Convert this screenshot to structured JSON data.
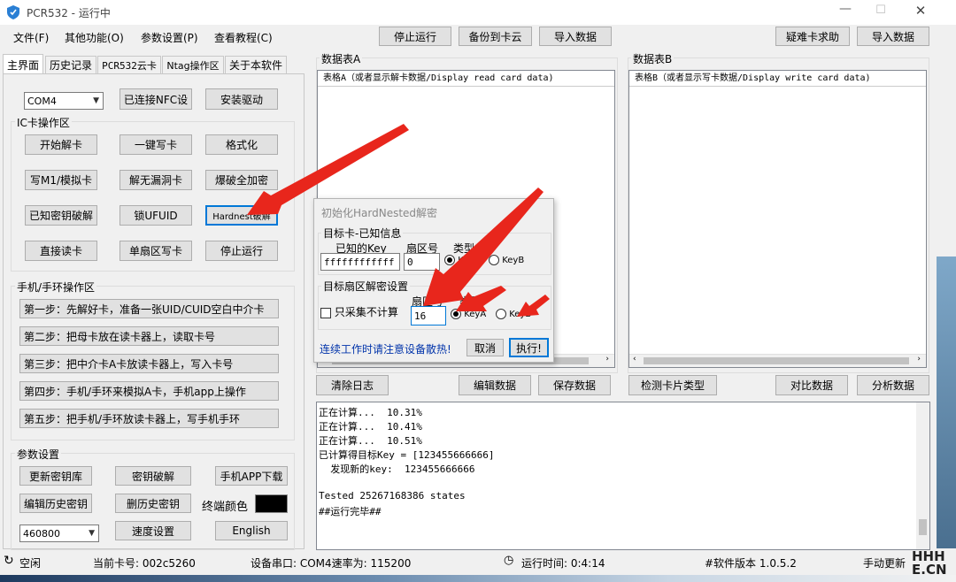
{
  "titlebar": {
    "title": "PCR532 - 运行中"
  },
  "menu": [
    "文件(F)",
    "其他功能(O)",
    "参数设置(P)",
    "查看教程(C)"
  ],
  "toolbar": {
    "stop": "停止运行",
    "backup": "备份到卡云",
    "import1": "导入数据",
    "help": "疑难卡求助",
    "import2": "导入数据"
  },
  "tabs": [
    "主界面",
    "历史记录",
    "PCR532云卡",
    "Ntag操作区",
    "关于本软件"
  ],
  "top": {
    "port": "COM4",
    "connected": "已连接NFC设",
    "install": "安装驱动"
  },
  "ic": {
    "title": "IC卡操作区",
    "buttons": [
      "开始解卡",
      "一键写卡",
      "格式化",
      "写M1/模拟卡",
      "解无漏洞卡",
      "爆破全加密",
      "已知密钥破解",
      "锁UFUID",
      "Hardnest破解",
      "直接读卡",
      "单扇区写卡",
      "停止运行"
    ]
  },
  "phone": {
    "title": "手机/手环操作区",
    "steps": [
      "第一步：先解好卡，准备一张UID/CUID空白中介卡",
      "第二步：把母卡放在读卡器上，读取卡号",
      "第三步：把中介卡A卡放读卡器上，写入卡号",
      "第四步：手机/手环来模拟A卡，手机app上操作",
      "第五步：把手机/手环放读卡器上，写手机手环"
    ]
  },
  "params": {
    "title": "参数设置",
    "update_keys": "更新密钥库",
    "key_crack": "密钥破解",
    "app_download": "手机APP下载",
    "edit_history": "编辑历史密钥",
    "delete_history": "删历史密钥",
    "terminal_color_label": "终端颜色",
    "baud": "460800",
    "speed": "速度设置",
    "english": "English"
  },
  "tableA": {
    "group": "数据表A",
    "header": "表格A（或者显示解卡数据/Display read card data)"
  },
  "tableB": {
    "group": "数据表B",
    "header": "表格B（或者显示写卡数据/Display write card data)"
  },
  "actions": {
    "clear": "清除日志",
    "edit": "编辑数据",
    "save": "保存数据",
    "detect": "检测卡片类型",
    "compare": "对比数据",
    "analyze": "分析数据"
  },
  "log": [
    "正在计算...  10.31%",
    "正在计算...  10.41%",
    "正在计算...  10.51%",
    "已计算得目标Key = [123455666666]",
    "  发现新的key:  123455666666",
    "",
    "Tested 25267168386 states",
    "##运行完毕##"
  ],
  "dialog": {
    "title": "初始化HardNested解密",
    "target_title": "目标卡-已知信息",
    "known_key_label": "已知的Key",
    "sector_label": "扇区号",
    "type_label": "类型",
    "known_key": "ffffffffffff",
    "sector": "0",
    "keya": "KeyA",
    "keyb": "KeyB",
    "target_sector_title": "目标扇区解密设置",
    "collect_only": "只采集不计算",
    "sector2_label": "扇区号",
    "type2_label": "类型",
    "sector2": "16",
    "warning": "连续工作时请注意设备散热!",
    "cancel": "取消",
    "execute": "执行!"
  },
  "status": {
    "idle": "空闲",
    "card": "当前卡号: 002c5260",
    "port": "设备串口: COM4速率为: 115200",
    "runtime": "运行时间: 0:4:14",
    "version": "#软件版本 1.0.5.2",
    "update": "手动更新"
  },
  "watermark": "HHH E.CN",
  "colors": {
    "accent": "#0078d7",
    "arrow": "#e8261c",
    "link": "#0033aa",
    "terminal": "#000000"
  }
}
